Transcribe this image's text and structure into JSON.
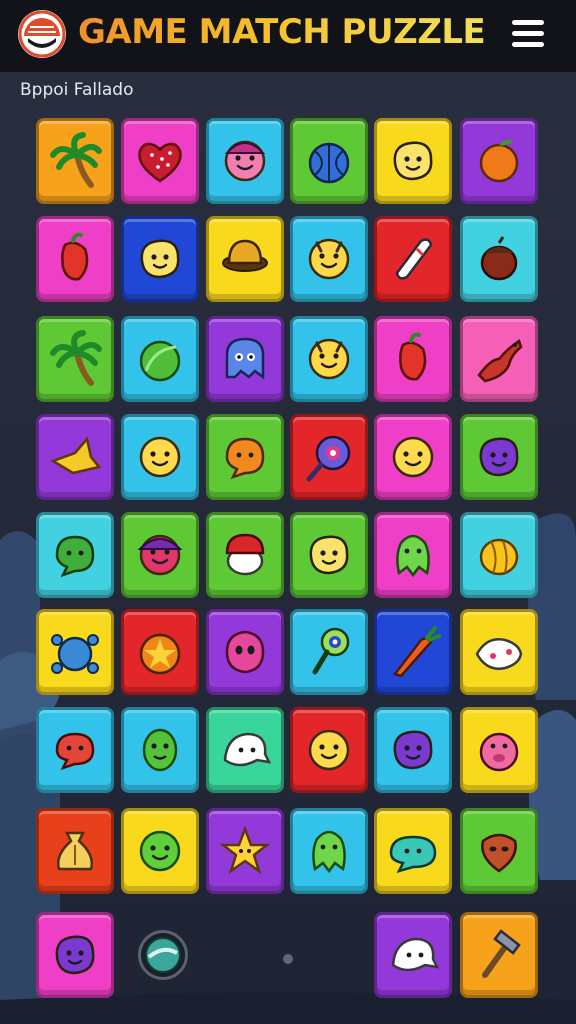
{
  "header": {
    "title": "GAME MATCH PUZZLE",
    "logo_icon": "game-logo-icon",
    "menu_icon": "hamburger-menu-icon"
  },
  "subtitle": "Bppoi Fallado",
  "board": {
    "rows": [
      [
        {
          "color": "#f7a21b",
          "icon": "palm-tree"
        },
        {
          "color": "#ee3fc6",
          "icon": "strawberry-heart"
        },
        {
          "color": "#33c3ea",
          "icon": "pink-hat-face"
        },
        {
          "color": "#5ec935",
          "icon": "blue-berry"
        },
        {
          "color": "#f9d91c",
          "icon": "smiley-blob"
        },
        {
          "color": "#9339d9",
          "icon": "orange-fruit"
        }
      ],
      [
        {
          "color": "#ee3fc6",
          "icon": "red-pepper"
        },
        {
          "color": "#2147d6",
          "icon": "smiley-blob"
        },
        {
          "color": "#f9d91c",
          "icon": "brown-hat"
        },
        {
          "color": "#33c3ea",
          "icon": "yellow-critter"
        },
        {
          "color": "#e3262a",
          "icon": "bowling-pin"
        },
        {
          "color": "#42d1e0",
          "icon": "acorn"
        }
      ],
      [
        {
          "color": "#5ec935",
          "icon": "palm-tree"
        },
        {
          "color": "#33c3ea",
          "icon": "green-ball"
        },
        {
          "color": "#9339d9",
          "icon": "blue-ghost"
        },
        {
          "color": "#33c3ea",
          "icon": "yellow-critter"
        },
        {
          "color": "#ee3fc6",
          "icon": "red-pepper"
        },
        {
          "color": "#f55fb6",
          "icon": "red-lizard"
        }
      ],
      [
        {
          "color": "#9339d9",
          "icon": "yellow-star-shard"
        },
        {
          "color": "#33c3ea",
          "icon": "yellow-face"
        },
        {
          "color": "#5ec935",
          "icon": "orange-bubble"
        },
        {
          "color": "#e3262a",
          "icon": "eye-orb"
        },
        {
          "color": "#ee3fc6",
          "icon": "yellow-face"
        },
        {
          "color": "#5ec935",
          "icon": "purple-blob"
        }
      ],
      [
        {
          "color": "#42d1e0",
          "icon": "green-bubble"
        },
        {
          "color": "#5ec935",
          "icon": "hat-critter"
        },
        {
          "color": "#5ec935",
          "icon": "red-cap-mushroom"
        },
        {
          "color": "#5ec935",
          "icon": "smiley-blob"
        },
        {
          "color": "#ee3fc6",
          "icon": "green-ghost"
        },
        {
          "color": "#42d1e0",
          "icon": "yellow-shell"
        }
      ],
      [
        {
          "color": "#f9d91c",
          "icon": "blue-crab"
        },
        {
          "color": "#e3262a",
          "icon": "orange-star-ball"
        },
        {
          "color": "#9339d9",
          "icon": "pink-alien"
        },
        {
          "color": "#33c3ea",
          "icon": "eye-lollipop"
        },
        {
          "color": "#2147d6",
          "icon": "carrot"
        },
        {
          "color": "#f9d91c",
          "icon": "white-fish"
        }
      ],
      [
        {
          "color": "#33c3ea",
          "icon": "red-bubble"
        },
        {
          "color": "#33c3ea",
          "icon": "green-alien"
        },
        {
          "color": "#38d69a",
          "icon": "white-ghost"
        },
        {
          "color": "#e3262a",
          "icon": "yellow-face"
        },
        {
          "color": "#33c3ea",
          "icon": "purple-blob"
        },
        {
          "color": "#f9d91c",
          "icon": "pink-pig"
        }
      ],
      [
        {
          "color": "#e8401b",
          "icon": "yellow-bag"
        },
        {
          "color": "#f9d91c",
          "icon": "green-face"
        },
        {
          "color": "#9339d9",
          "icon": "yellow-star"
        },
        {
          "color": "#33c3ea",
          "icon": "green-ghost"
        },
        {
          "color": "#f9d91c",
          "icon": "teal-bubble"
        },
        {
          "color": "#5ec935",
          "icon": "brown-mask"
        }
      ],
      [
        {
          "color": "#ee3fc6",
          "icon": "purple-blob"
        },
        null,
        null,
        null,
        {
          "color": "#9339d9",
          "icon": "white-ghost"
        },
        {
          "color": "#f7a21b",
          "icon": "hammer"
        }
      ]
    ]
  },
  "bonus_coin_icon": "marble-coin-icon",
  "page_indicator_icon": "page-dot-icon"
}
